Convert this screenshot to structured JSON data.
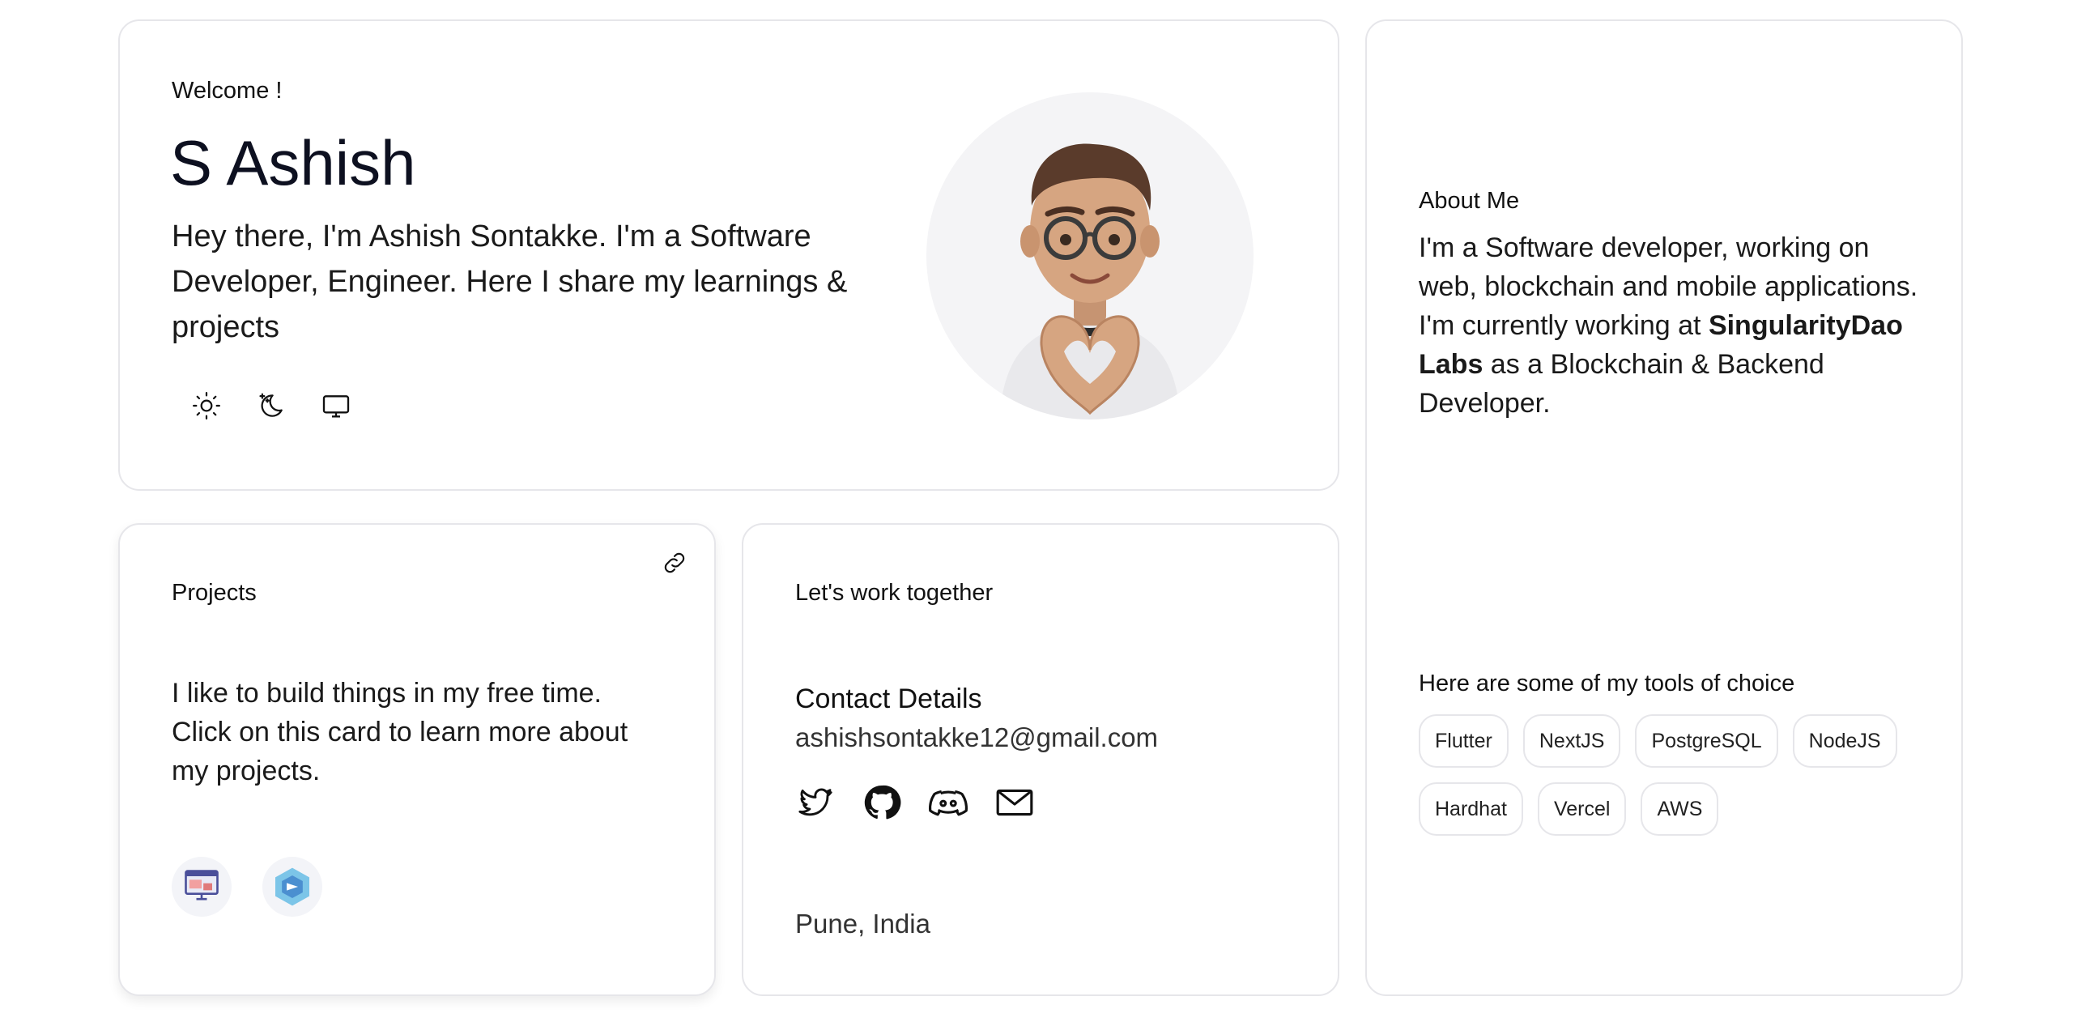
{
  "hero": {
    "welcome": "Welcome !",
    "name": "S Ashish",
    "bio": "Hey there, I'm Ashish Sontakke. I'm a Software Developer, Engineer. Here I share my learnings & projects",
    "theme_icons": [
      "sun-icon",
      "moon-icon",
      "monitor-icon"
    ]
  },
  "about": {
    "title": "About Me",
    "body_before": "I'm a Software developer, working on web, blockchain and mobile applications. I'm currently working at ",
    "company": "SingularityDao Labs",
    "body_after": " as a Blockchain & Backend Developer.",
    "tools_title": "Here are some of my tools of choice",
    "tools": [
      "Flutter",
      "NextJS",
      "PostgreSQL",
      "NodeJS",
      "Hardhat",
      "Vercel",
      "AWS"
    ]
  },
  "projects": {
    "title": "Projects",
    "body": "I like to build things in my free time. Click on this card to learn more about my projects.",
    "logo_icons": [
      "project-monitor-icon",
      "project-hexagon-icon"
    ]
  },
  "contact": {
    "title": "Let's work together",
    "heading": "Contact Details",
    "email": "ashishsontakke12@gmail.com",
    "social_icons": [
      "twitter-icon",
      "github-icon",
      "discord-icon",
      "mail-icon"
    ],
    "location": "Pune, India"
  },
  "colors": {
    "border": "#e6e6ea",
    "text": "#111111",
    "avatar_bg": "#f4f4f6"
  }
}
